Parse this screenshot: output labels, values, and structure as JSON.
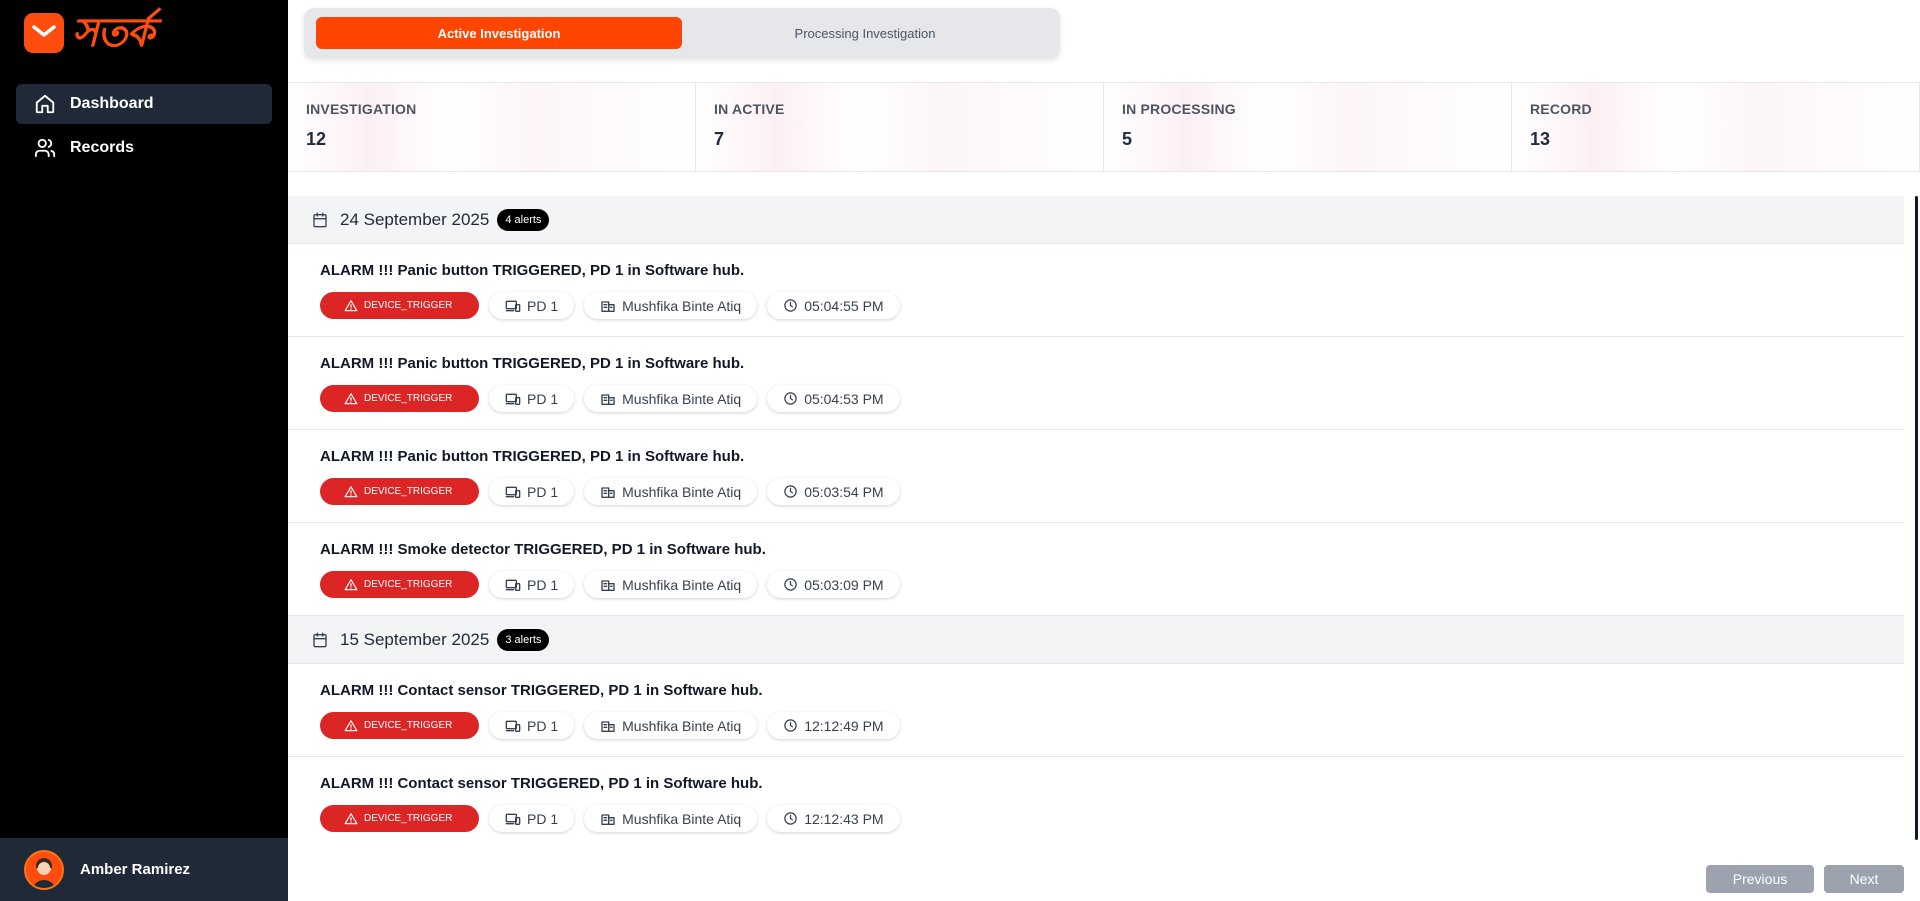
{
  "app": {
    "logo_text": "সতর্ক"
  },
  "sidebar": {
    "items": [
      {
        "label": "Dashboard",
        "icon": "home-icon",
        "active": true
      },
      {
        "label": "Records",
        "icon": "users-icon",
        "active": false
      }
    ],
    "user": {
      "name": "Amber Ramirez"
    }
  },
  "tabs": [
    {
      "label": "Active Investigation",
      "active": true
    },
    {
      "label": "Processing Investigation",
      "active": false
    }
  ],
  "stats": [
    {
      "label": "INVESTIGATION",
      "value": "12"
    },
    {
      "label": "IN ACTIVE",
      "value": "7"
    },
    {
      "label": "IN PROCESSING",
      "value": "5"
    },
    {
      "label": "RECORD",
      "value": "13"
    }
  ],
  "groups": [
    {
      "date": "24 September 2025",
      "badge": "4 alerts",
      "alerts": [
        {
          "title": "ALARM !!! Panic button TRIGGERED, PD 1 in Software hub.",
          "type": "DEVICE_TRIGGER",
          "device": "PD 1",
          "user": "Mushfika Binte Atiq",
          "time": "05:04:55 PM"
        },
        {
          "title": "ALARM !!! Panic button TRIGGERED, PD 1 in Software hub.",
          "type": "DEVICE_TRIGGER",
          "device": "PD 1",
          "user": "Mushfika Binte Atiq",
          "time": "05:04:53 PM"
        },
        {
          "title": "ALARM !!! Panic button TRIGGERED, PD 1 in Software hub.",
          "type": "DEVICE_TRIGGER",
          "device": "PD 1",
          "user": "Mushfika Binte Atiq",
          "time": "05:03:54 PM"
        },
        {
          "title": "ALARM !!! Smoke detector TRIGGERED, PD 1 in Software hub.",
          "type": "DEVICE_TRIGGER",
          "device": "PD 1",
          "user": "Mushfika Binte Atiq",
          "time": "05:03:09 PM"
        }
      ]
    },
    {
      "date": "15 September 2025",
      "badge": "3 alerts",
      "alerts": [
        {
          "title": "ALARM !!! Contact sensor TRIGGERED, PD 1 in Software hub.",
          "type": "DEVICE_TRIGGER",
          "device": "PD 1",
          "user": "Mushfika Binte Atiq",
          "time": "12:12:49 PM"
        },
        {
          "title": "ALARM !!! Contact sensor TRIGGERED, PD 1 in Software hub.",
          "type": "DEVICE_TRIGGER",
          "device": "PD 1",
          "user": "Mushfika Binte Atiq",
          "time": "12:12:43 PM"
        }
      ]
    }
  ],
  "pagination": {
    "previous_label": "Previous",
    "next_label": "Next"
  },
  "colors": {
    "brand": "#ff4d0f",
    "trigger": "#dc2626",
    "sidebar": "#000000"
  }
}
